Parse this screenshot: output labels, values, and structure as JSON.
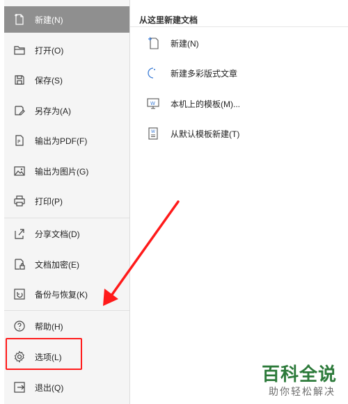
{
  "menu": {
    "items": [
      {
        "label": "新建(N)",
        "icon": "new-doc-icon",
        "active": true
      },
      {
        "label": "打开(O)",
        "icon": "folder-open-icon"
      },
      {
        "label": "保存(S)",
        "icon": "save-icon"
      },
      {
        "label": "另存为(A)",
        "icon": "save-as-icon"
      },
      {
        "label": "输出为PDF(F)",
        "icon": "pdf-export-icon"
      },
      {
        "label": "输出为图片(G)",
        "icon": "image-export-icon"
      },
      {
        "label": "打印(P)",
        "icon": "printer-icon"
      },
      {
        "label": "分享文档(D)",
        "icon": "share-icon"
      },
      {
        "label": "文档加密(E)",
        "icon": "encrypt-icon"
      },
      {
        "label": "备份与恢复(K)",
        "icon": "backup-restore-icon"
      },
      {
        "label": "帮助(H)",
        "icon": "help-icon"
      },
      {
        "label": "选项(L)",
        "icon": "gear-icon"
      },
      {
        "label": "退出(Q)",
        "icon": "exit-icon"
      }
    ]
  },
  "panel": {
    "title": "从这里新建文档",
    "items": [
      {
        "label": "新建(N)",
        "icon": "blank-doc-icon"
      },
      {
        "label": "新建多彩版式文章",
        "icon": "colorful-article-icon"
      },
      {
        "label": "本机上的模板(M)...",
        "icon": "local-template-icon"
      },
      {
        "label": "从默认模板新建(T)",
        "icon": "default-template-icon"
      }
    ]
  },
  "watermark": {
    "title": "百科全说",
    "subtitle": "助你轻松解决"
  },
  "colors": {
    "highlight": "#ff1a1a",
    "active_bg": "#8f8f8f",
    "brand_green": "#2c7a3a"
  }
}
